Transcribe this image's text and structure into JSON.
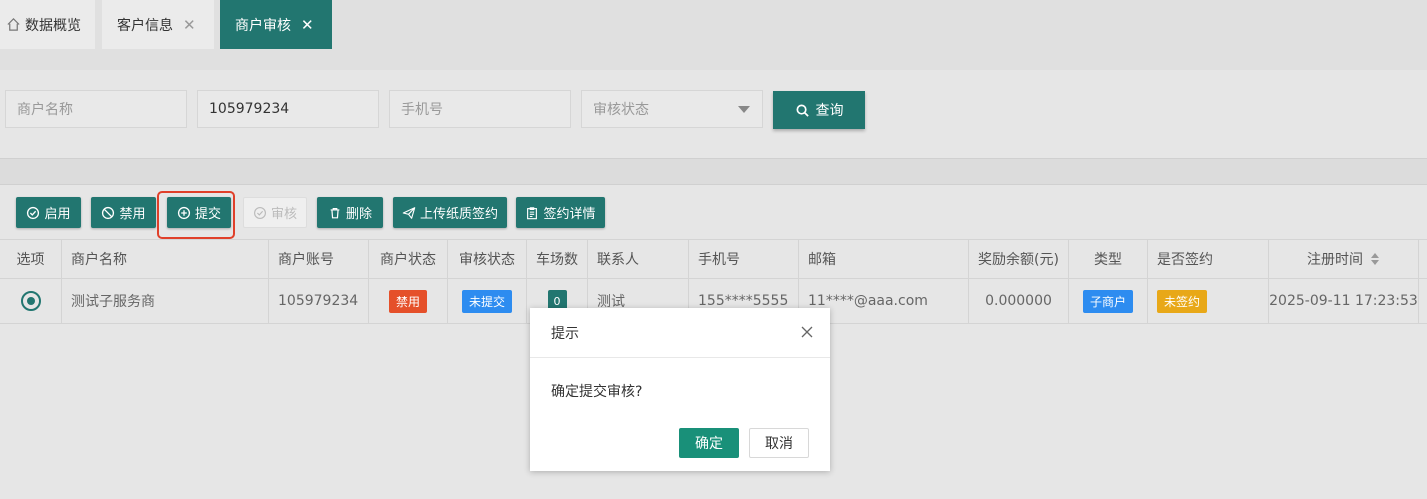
{
  "tabs": [
    {
      "label": "数据概览",
      "icon": "home-icon"
    },
    {
      "label": "客户信息",
      "close": "✕"
    },
    {
      "label": "商户审核",
      "close": "✕"
    }
  ],
  "search": {
    "merchant_name_placeholder": "商户名称",
    "account_value": "105979234",
    "phone_placeholder": "手机号",
    "audit_status_placeholder": "审核状态",
    "query_label": "查询"
  },
  "toolbar": {
    "enable": "启用",
    "disable": "禁用",
    "submit": "提交",
    "audit": "审核",
    "delete": "删除",
    "upload": "上传纸质签约",
    "detail": "签约详情"
  },
  "table": {
    "headers": [
      "选项",
      "商户名称",
      "商户账号",
      "商户状态",
      "审核状态",
      "车场数",
      "联系人",
      "手机号",
      "邮箱",
      "奖励余额(元)",
      "类型",
      "是否签约",
      "注册时间"
    ],
    "rows": [
      {
        "name": "测试子服务商",
        "account": "105979234",
        "merchant_status": "禁用",
        "audit_status": "未提交",
        "lots": "0",
        "contact": "测试",
        "phone": "155****5555",
        "email": "11****@aaa.com",
        "balance": "0.000000",
        "type": "子商户",
        "signed": "未签约",
        "registered": "2025-09-11 17:23:53"
      }
    ]
  },
  "modal": {
    "title": "提示",
    "message": "确定提交审核?",
    "ok": "确定",
    "cancel": "取消"
  },
  "colors": {
    "primary": "#227670",
    "danger": "#e5502a",
    "info": "#2d8cf0",
    "warning": "#e8a818",
    "highlight": "#e0402a"
  }
}
